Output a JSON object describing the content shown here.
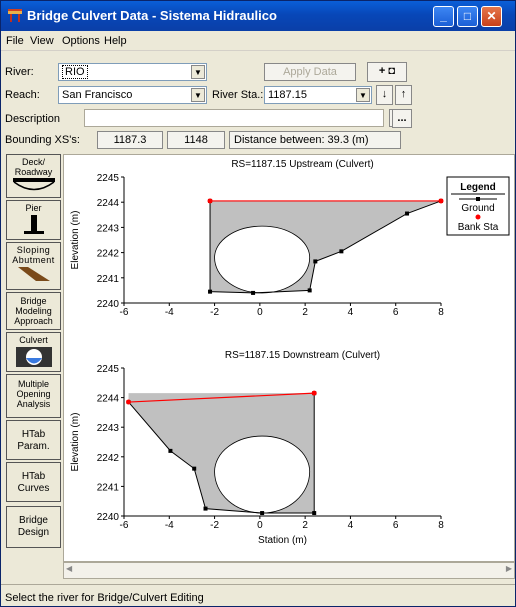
{
  "window": {
    "title": "Bridge Culvert Data - Sistema Hidraulico"
  },
  "menu": [
    "File",
    "View",
    "Options",
    "Help"
  ],
  "river": {
    "label": "River:",
    "value": "RIO"
  },
  "apply_label": "Apply Data",
  "reach": {
    "label": "Reach:",
    "value": "San Francisco"
  },
  "river_sta": {
    "label": "River Sta.:",
    "value": "1187.15"
  },
  "description": {
    "label": "Description",
    "value": ""
  },
  "bounding": {
    "label": "Bounding XS's:",
    "xs1": "1187.3",
    "xs2": "1148",
    "distance": "Distance between: 39.3 (m)"
  },
  "sidebar": [
    "Deck/ Roadway",
    "Pier",
    "Sloping Abutment",
    "Bridge Modeling Approach",
    "Culvert",
    "Multiple Opening Analysis",
    "HTab Param.",
    "HTab Curves",
    "Bridge Design"
  ],
  "status": "Select the river for Bridge/Culvert Editing",
  "colors": {
    "ground": "#000000",
    "bank": "#ff0000",
    "fill": "#c0c0c0"
  },
  "chart_data": [
    {
      "type": "line",
      "title": "RS=1187.15 Upstream  (Culvert)",
      "xlabel": "",
      "ylabel": "Elevation (m)",
      "xlim": [
        -6,
        8
      ],
      "ylim": [
        2240,
        2245
      ],
      "xticks": [
        "-6",
        "-4",
        "-2",
        "0",
        "2",
        "4",
        "6",
        "8"
      ],
      "yticks": [
        "2240",
        "2241",
        "2242",
        "2243",
        "2244",
        "2245"
      ],
      "ground": {
        "x": [
          -2.2,
          -2.2,
          -0.3,
          2.2,
          2.45,
          3.6,
          6.5,
          8.0
        ],
        "y": [
          2244.05,
          2240.45,
          2240.4,
          2240.5,
          2241.65,
          2242.05,
          2243.55,
          2244.05
        ]
      },
      "bank": {
        "x": [
          -2.2,
          8.0
        ],
        "y": [
          2244.05,
          2244.05
        ]
      },
      "deck_y": 2244.05,
      "culvert": {
        "x_left": -2.0,
        "x_right": 2.2,
        "invert": 2240.4,
        "springline": 2241.8,
        "crown": 2243.05
      },
      "legend": {
        "title": "Legend",
        "items": [
          "Ground",
          "Bank Sta"
        ]
      }
    },
    {
      "type": "line",
      "title": "RS=1187.15 Downstream  (Culvert)",
      "xlabel": "Station (m)",
      "ylabel": "Elevation (m)",
      "xlim": [
        -6,
        8
      ],
      "ylim": [
        2240,
        2245
      ],
      "xticks": [
        "-6",
        "-4",
        "-2",
        "0",
        "2",
        "4",
        "6",
        "8"
      ],
      "yticks": [
        "2240",
        "2241",
        "2242",
        "2243",
        "2244",
        "2245"
      ],
      "ground": {
        "x": [
          -5.8,
          -3.95,
          -2.9,
          -2.4,
          0.1,
          2.4,
          2.4
        ],
        "y": [
          2243.85,
          2242.2,
          2241.6,
          2240.25,
          2240.1,
          2240.1,
          2244.15
        ]
      },
      "bank": {
        "x": [
          -5.8,
          2.4
        ],
        "y": [
          2243.85,
          2244.15
        ]
      },
      "deck_y": 2244.15,
      "culvert": {
        "x_left": -2.0,
        "x_right": 2.2,
        "invert": 2240.1,
        "springline": 2241.5,
        "crown": 2242.7
      }
    }
  ]
}
